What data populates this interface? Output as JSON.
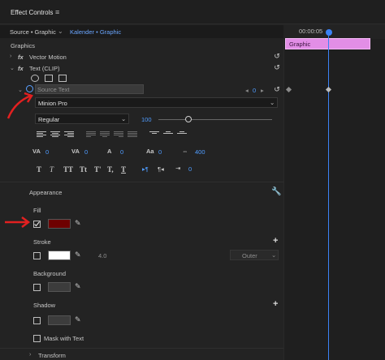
{
  "panel": {
    "title": "Effect Controls",
    "menu_icon": "hamburger-menu-icon"
  },
  "tabs": {
    "source_label": "Source • Graphic",
    "sequence_label": "Kalender • Graphic"
  },
  "timeline": {
    "timecode": "00:00:05",
    "clip_label": "Graphic"
  },
  "tree": {
    "group_label": "Graphics",
    "vector_motion_label": "Vector Motion",
    "text_label": "Text (CLIP)",
    "source_text_label": "Source Text",
    "source_text_keyframe_value": "0"
  },
  "font": {
    "family": "Minion Pro",
    "style": "Regular",
    "size": "100"
  },
  "text_values": {
    "tracking": "0",
    "kerning": "0",
    "leading": "0",
    "baseline": "0",
    "tsume": "400",
    "tab_value": "0"
  },
  "typography_labels": {
    "b1": "T",
    "b2": "T",
    "b3": "TT",
    "b4": "Tt",
    "b5": "T'",
    "b6": "T,",
    "b7": "T"
  },
  "appearance": {
    "title": "Appearance",
    "fill_label": "Fill",
    "fill_color": "#6e0000",
    "fill_checked": true,
    "stroke_label": "Stroke",
    "stroke_color": "#ffffff",
    "stroke_width": "4.0",
    "stroke_position": "Outer",
    "background_label": "Background",
    "shadow_label": "Shadow",
    "mask_label": "Mask with Text"
  },
  "transform": {
    "label": "Transform"
  },
  "colors": {
    "accent_blue": "#4f9cff",
    "clip_pink": "#e28ee6",
    "annotation_red": "#e22020"
  }
}
